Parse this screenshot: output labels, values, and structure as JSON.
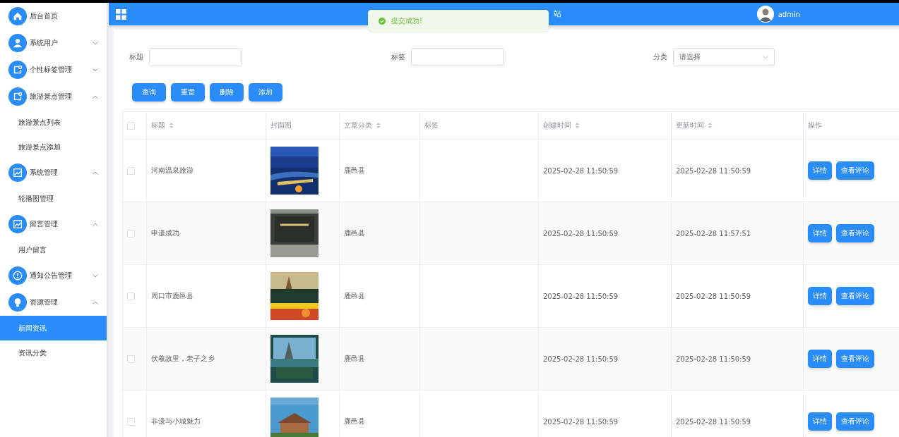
{
  "sidebar": {
    "items": [
      {
        "label": "后台首页"
      },
      {
        "label": "系统用户",
        "expanded": false
      },
      {
        "label": "个性标签管理",
        "expanded": false
      },
      {
        "label": "旅游景点管理",
        "expanded": true,
        "children": [
          {
            "label": "旅游景点列表",
            "selected": false
          },
          {
            "label": "旅游景点添加",
            "selected": false
          }
        ]
      },
      {
        "label": "系统管理",
        "expanded": true,
        "children": [
          {
            "label": "轮播图管理",
            "selected": false
          }
        ]
      },
      {
        "label": "留言管理",
        "expanded": true,
        "children": [
          {
            "label": "用户留言",
            "selected": false
          }
        ]
      },
      {
        "label": "通知公告管理",
        "expanded": false
      },
      {
        "label": "资源管理",
        "expanded": true,
        "children": [
          {
            "label": "新闻资讯",
            "selected": true
          },
          {
            "label": "资讯分类",
            "selected": false
          }
        ]
      }
    ]
  },
  "header": {
    "title": "站",
    "user": "admin"
  },
  "toast": {
    "message": "提交成功!"
  },
  "filters": [
    {
      "label": "标题",
      "kind": "text"
    },
    {
      "label": "标签",
      "kind": "text"
    },
    {
      "label": "分类",
      "kind": "select",
      "placeholder": "请选择"
    }
  ],
  "buttons": [
    "查询",
    "重置",
    "删除",
    "添加"
  ],
  "table": {
    "all_checked": false,
    "columns": [
      {
        "label": "标题",
        "sortable": true
      },
      {
        "label": "封面图",
        "sortable": false
      },
      {
        "label": "文章分类",
        "sortable": true
      },
      {
        "label": "标签",
        "sortable": false
      },
      {
        "label": "创建时间",
        "sortable": true
      },
      {
        "label": "更新时间",
        "sortable": true
      },
      {
        "label": "操作",
        "sortable": false
      }
    ],
    "rows": [
      {
        "checked": false,
        "title": "河南温泉旅游",
        "category": "鹿邑县",
        "created": "2025-02-28 11:50:59",
        "updated": "2025-02-28 11:50:59",
        "actions": [
          "详情",
          "查看评论"
        ]
      },
      {
        "checked": false,
        "title": "申遗成功",
        "category": "鹿邑县",
        "created": "2025-02-28 11:50:59",
        "updated": "2025-02-28 11:57:51",
        "actions": [
          "详情",
          "查看评论"
        ]
      },
      {
        "checked": false,
        "title": "周口市鹿邑县",
        "category": "鹿邑县",
        "created": "2025-02-28 11:50:59",
        "updated": "2025-02-28 11:50:59",
        "actions": [
          "详情",
          "查看评论"
        ]
      },
      {
        "checked": false,
        "title": "伏羲故里，老子之乡",
        "category": "鹿邑县",
        "created": "2025-02-28 11:50:59",
        "updated": "2025-02-28 11:50:59",
        "actions": [
          "详情",
          "查看评论"
        ]
      },
      {
        "checked": false,
        "title": "非遗与小城魅力",
        "category": "鹿邑县",
        "created": "2025-02-28 11:50:59",
        "updated": "2025-02-28 11:50:59",
        "actions": [
          "详情",
          "查看评论"
        ]
      }
    ]
  }
}
